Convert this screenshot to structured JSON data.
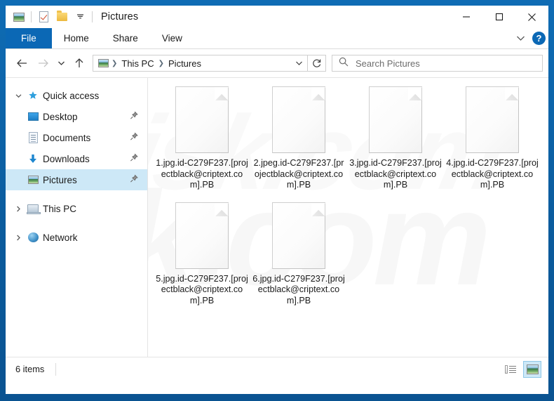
{
  "window": {
    "title": "Pictures",
    "quick_access_toolbar": [
      {
        "name": "picture-icon",
        "tooltip": "Pictures"
      },
      {
        "name": "properties-icon",
        "tooltip": "Properties"
      },
      {
        "name": "new-folder-icon",
        "tooltip": "New folder"
      },
      {
        "name": "chevron-down-icon",
        "tooltip": "Customize Quick Access Toolbar"
      }
    ],
    "controls": {
      "minimize": "—",
      "maximize": "☐",
      "close": "✕"
    },
    "border_color": "#0b5c9e"
  },
  "ribbon": {
    "tabs": [
      {
        "label": "File",
        "active": true
      },
      {
        "label": "Home",
        "active": false
      },
      {
        "label": "Share",
        "active": false
      },
      {
        "label": "View",
        "active": false
      }
    ],
    "file_tab_color": "#0b68b5",
    "expand_icon": "chevron-down-icon",
    "help_label": "?"
  },
  "addressbar": {
    "back_icon": "←",
    "forward_icon": "→",
    "recent_icon": "⌄",
    "up_icon": "↑",
    "breadcrumb_root_icon": "pictures-icon",
    "breadcrumbs": [
      "This PC",
      "Pictures"
    ],
    "separator": "❯",
    "dropdown_icon": "⌄",
    "refresh_icon": "↻"
  },
  "search": {
    "icon": "search-icon",
    "placeholder": "Search Pictures",
    "value": ""
  },
  "sidebar": {
    "items": [
      {
        "label": "Quick access",
        "icon": "star-icon",
        "expander": "⌄",
        "level": 0,
        "selected": false,
        "pinned": false
      },
      {
        "label": "Desktop",
        "icon": "desktop-icon",
        "level": 1,
        "selected": false,
        "pinned": true
      },
      {
        "label": "Documents",
        "icon": "documents-icon",
        "level": 1,
        "selected": false,
        "pinned": true
      },
      {
        "label": "Downloads",
        "icon": "download-icon",
        "level": 1,
        "selected": false,
        "pinned": true
      },
      {
        "label": "Pictures",
        "icon": "pictures-icon",
        "level": 1,
        "selected": true,
        "pinned": true
      },
      {
        "label": "This PC",
        "icon": "computer-icon",
        "expander": "›",
        "level": 0,
        "selected": false,
        "pinned": false
      },
      {
        "label": "Network",
        "icon": "network-icon",
        "expander": "›",
        "level": 0,
        "selected": false,
        "pinned": false
      }
    ],
    "pin_glyph": "📌",
    "selection_color": "#cde8f7"
  },
  "content": {
    "watermark_text": "risk.com",
    "files": [
      {
        "name": "1.jpg.id-C279F237.[projectblack@criptext.com].PB",
        "icon": "blank-file-icon"
      },
      {
        "name": "2.jpeg.id-C279F237.[projectblack@criptext.com].PB",
        "icon": "blank-file-icon"
      },
      {
        "name": "3.jpg.id-C279F237.[projectblack@criptext.com].PB",
        "icon": "blank-file-icon"
      },
      {
        "name": "4.jpg.id-C279F237.[projectblack@criptext.com].PB",
        "icon": "blank-file-icon"
      },
      {
        "name": "5.jpg.id-C279F237.[projectblack@criptext.com].PB",
        "icon": "blank-file-icon"
      },
      {
        "name": "6.jpg.id-C279F237.[projectblack@criptext.com].PB",
        "icon": "blank-file-icon"
      }
    ]
  },
  "statusbar": {
    "item_count": "6 items",
    "view_buttons": [
      {
        "name": "details-view-button",
        "active": false
      },
      {
        "name": "large-icons-view-button",
        "active": true
      }
    ]
  }
}
